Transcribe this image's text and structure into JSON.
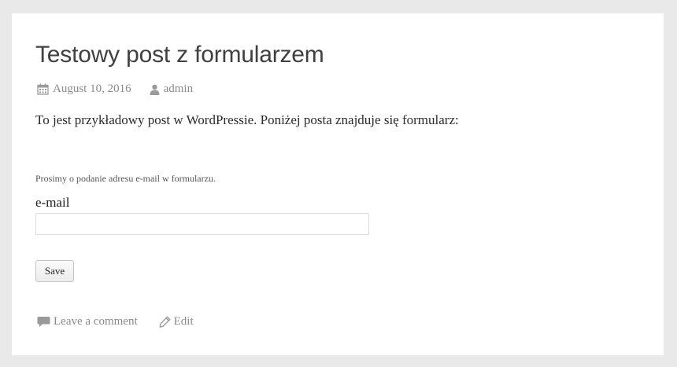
{
  "post": {
    "title": "Testowy post z formularzem",
    "date": "August 10, 2016",
    "author": "admin",
    "intro": "To jest przykładowy post w WordPressie. Poniżej posta znajduje się formularz:"
  },
  "form": {
    "note": "Prosimy o podanie adresu e-mail w formularzu.",
    "email_label": "e-mail",
    "email_value": "",
    "save_label": "Save"
  },
  "footer": {
    "comment_label": "Leave a comment",
    "edit_label": "Edit"
  },
  "icons": {
    "date": "calendar-icon",
    "author": "user-icon",
    "comment": "speech-bubble-icon",
    "edit": "pencil-icon"
  },
  "colors": {
    "page_background": "#e9e9e9",
    "card_background": "#ffffff",
    "meta_text": "#8a8a8a"
  }
}
